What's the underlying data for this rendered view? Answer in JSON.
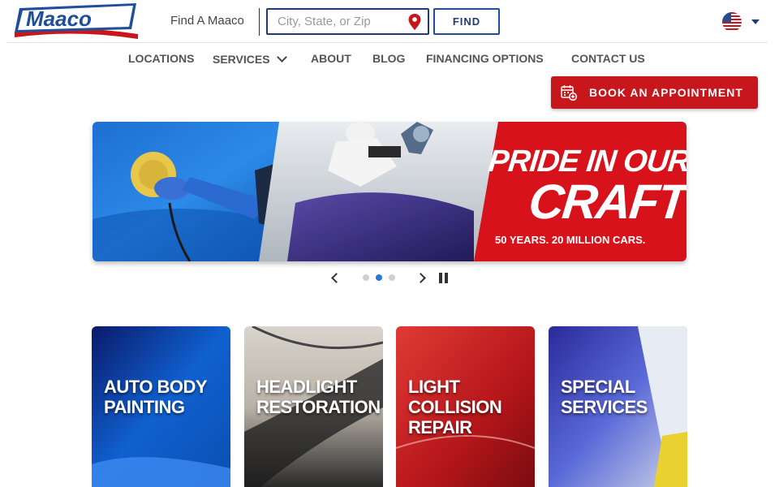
{
  "header": {
    "logo_alt": "Maaco",
    "find_label": "Find A Maaco",
    "search_placeholder": "City, State, or Zip",
    "find_button": "FIND",
    "language_flag": "us-flag-icon"
  },
  "nav": {
    "items": [
      {
        "label": "LOCATIONS"
      },
      {
        "label": "SERVICES",
        "has_dropdown": true
      },
      {
        "label": "ABOUT"
      },
      {
        "label": "BLOG"
      },
      {
        "label": "FINANCING OPTIONS"
      },
      {
        "label": "CONTACT US"
      }
    ],
    "book_button": "BOOK AN APPOINTMENT"
  },
  "hero": {
    "headline_line1": "PRIDE IN OUR",
    "headline_line2": "CRAFT",
    "subline": "50 YEARS. 20 MILLION CARS.",
    "slide_count": 3,
    "active_slide": 2
  },
  "services": [
    {
      "title": "AUTO BODY PAINTING"
    },
    {
      "title": "HEADLIGHT RESTORATION"
    },
    {
      "title": "LIGHT COLLISION REPAIR"
    },
    {
      "title": "SPECIAL SERVICES"
    }
  ],
  "colors": {
    "brand_blue": "#1f3d73",
    "brand_red": "#c8161d",
    "active_dot": "#2a77d4"
  }
}
